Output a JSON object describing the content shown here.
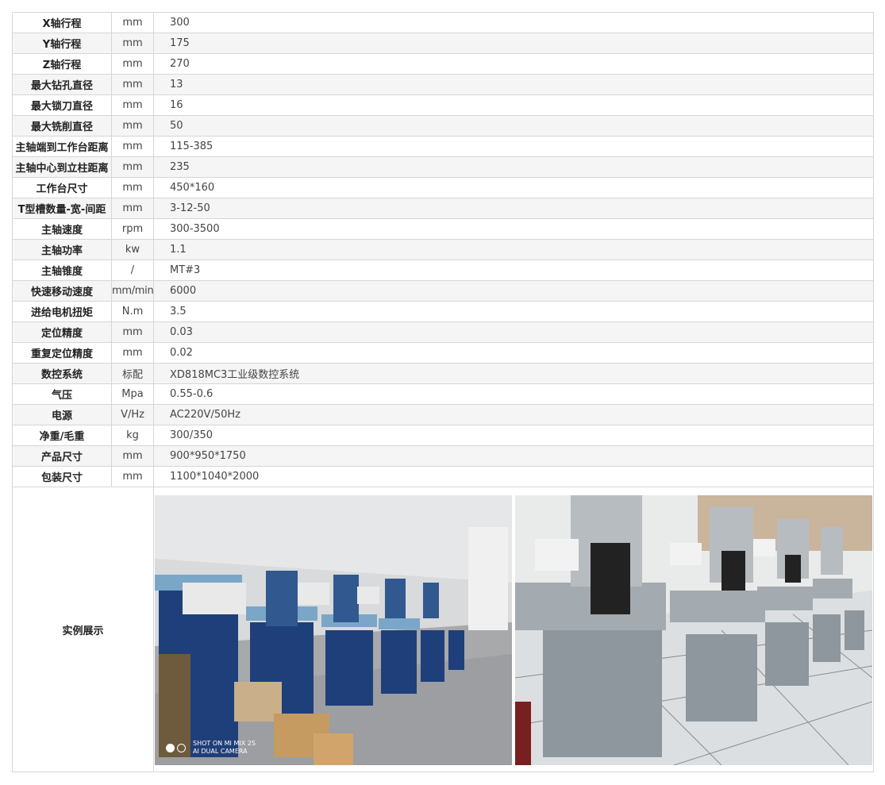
{
  "rows": [
    {
      "name": "X轴行程",
      "unit": "mm",
      "value": "300"
    },
    {
      "name": "Y轴行程",
      "unit": "mm",
      "value": "175"
    },
    {
      "name": "Z轴行程",
      "unit": "mm",
      "value": "270"
    },
    {
      "name": "最大钻孔直径",
      "unit": "mm",
      "value": "13"
    },
    {
      "name": "最大锁刀直径",
      "unit": "mm",
      "value": "16"
    },
    {
      "name": "最大铣削直径",
      "unit": "mm",
      "value": "50"
    },
    {
      "name": "主轴端到工作台距离",
      "unit": "mm",
      "value": "115-385"
    },
    {
      "name": "主轴中心到立柱距离",
      "unit": "mm",
      "value": "235"
    },
    {
      "name": "工作台尺寸",
      "unit": "mm",
      "value": "450*160"
    },
    {
      "name": "T型槽数量-宽-间距",
      "unit": "mm",
      "value": "3-12-50"
    },
    {
      "name": "主轴速度",
      "unit": "rpm",
      "value": "300-3500"
    },
    {
      "name": "主轴功率",
      "unit": "kw",
      "value": "1.1"
    },
    {
      "name": "主轴锥度",
      "unit": "/",
      "value": "MT#3"
    },
    {
      "name": "快速移动速度",
      "unit": "mm/min",
      "value": "6000"
    },
    {
      "name": "进给电机扭矩",
      "unit": "N.m",
      "value": "3.5"
    },
    {
      "name": "定位精度",
      "unit": "mm",
      "value": "0.03"
    },
    {
      "name": "重复定位精度",
      "unit": "mm",
      "value": "0.02"
    },
    {
      "name": "数控系统",
      "unit": "标配",
      "value": "XD818MC3工业级数控系统"
    },
    {
      "name": "气压",
      "unit": "Mpa",
      "value": "0.55-0.6"
    },
    {
      "name": "电源",
      "unit": "V/Hz",
      "value": "AC220V/50Hz"
    },
    {
      "name": "净重/毛重",
      "unit": "kg",
      "value": "300/350"
    },
    {
      "name": "产品尺寸",
      "unit": "mm",
      "value": "900*950*1750"
    },
    {
      "name": "包装尺寸",
      "unit": "mm",
      "value": "1100*1040*2000"
    }
  ],
  "showcase": {
    "label": "实例展示",
    "photo1_watermark": [
      "SHOT ON MI MIX 2S",
      "AI DUAL CAMERA"
    ]
  },
  "colors": {
    "border": "#d6d6d6",
    "alt_row": "#f5f5f5",
    "machine_blue": "#1f3f7a",
    "machine_grey": "#8e969e"
  }
}
